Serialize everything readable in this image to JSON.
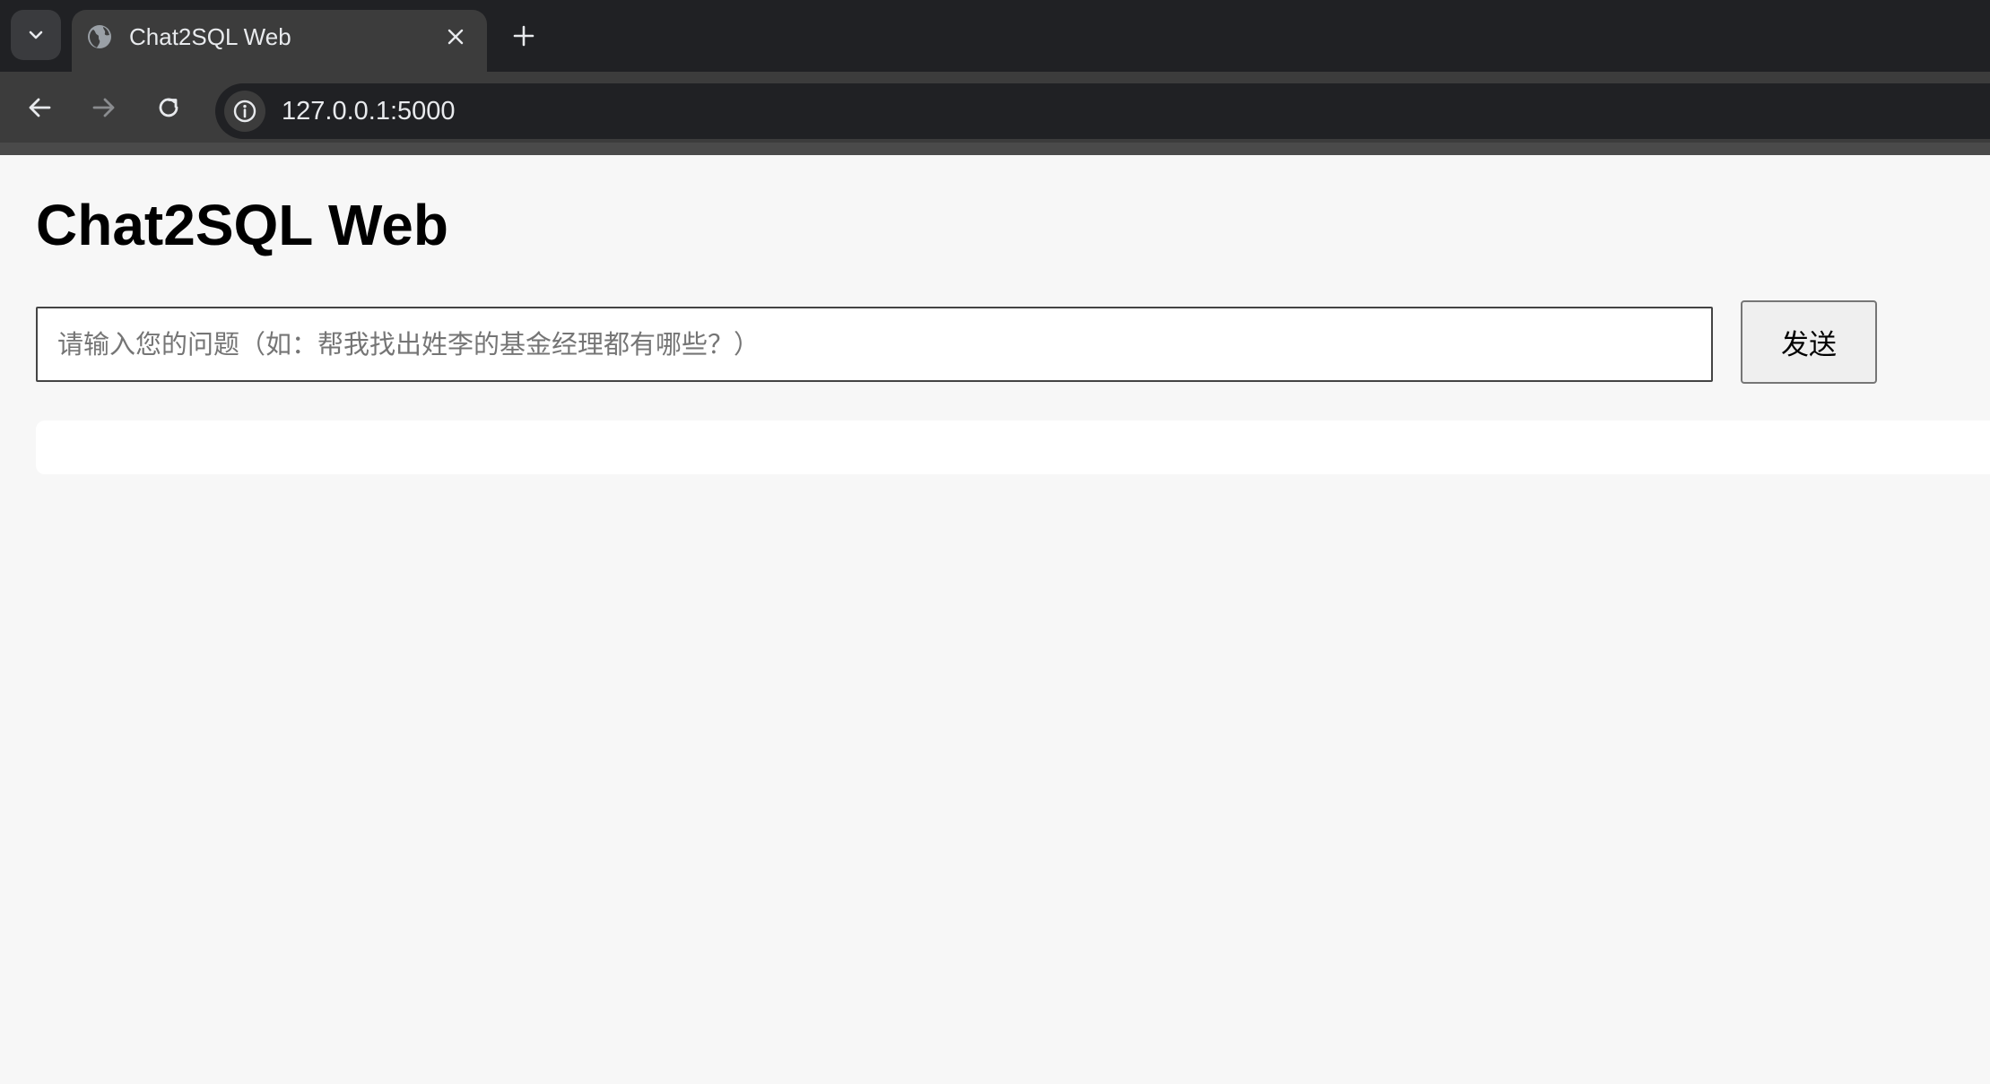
{
  "browser": {
    "tab": {
      "title": "Chat2SQL Web",
      "favicon": "globe-icon",
      "close_icon": "close-icon"
    },
    "tab_search_icon": "chevron-down-icon",
    "new_tab_icon": "plus-icon",
    "nav": {
      "back_icon": "arrow-left-icon",
      "forward_icon": "arrow-right-icon",
      "reload_icon": "reload-icon"
    },
    "omnibox": {
      "site_info_icon": "info-icon",
      "url": "127.0.0.1:5000"
    },
    "colors": {
      "tabstrip_bg": "#202124",
      "toolbar_bg": "#3c3c3c",
      "text": "#e8eaed"
    }
  },
  "page": {
    "title": "Chat2SQL Web",
    "question_input": {
      "value": "",
      "placeholder": "请输入您的问题（如：帮我找出姓李的基金经理都有哪些？）"
    },
    "send_button": {
      "label": "发送"
    },
    "result": {
      "text": ""
    },
    "colors": {
      "background": "#f7f7f7",
      "result_bg": "#ffffff"
    }
  }
}
